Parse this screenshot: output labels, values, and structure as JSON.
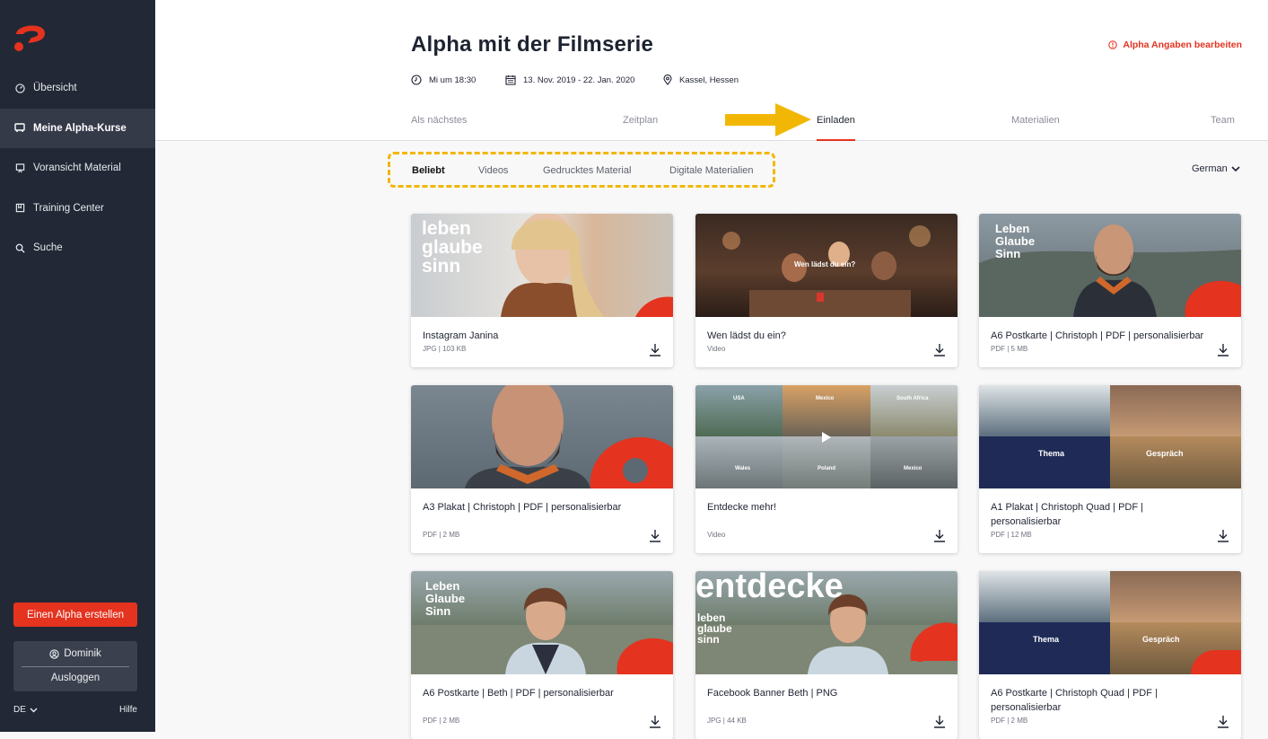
{
  "sidebar": {
    "nav": [
      {
        "label": "Übersicht",
        "icon": "dashboard-icon"
      },
      {
        "label": "Meine Alpha-Kurse",
        "icon": "course-icon"
      },
      {
        "label": "Voransicht Material",
        "icon": "preview-icon"
      },
      {
        "label": "Training Center",
        "icon": "book-icon"
      },
      {
        "label": "Suche",
        "icon": "search-icon"
      }
    ],
    "create_label": "Einen Alpha erstellen",
    "user_name": "Dominik",
    "logout_label": "Ausloggen",
    "lang_label": "DE",
    "help_label": "Hilfe"
  },
  "header": {
    "title": "Alpha mit der Filmserie",
    "edit_label": "Alpha Angaben bearbeiten",
    "time": "Mi um 18:30",
    "dates": "13. Nov. 2019 - 22. Jan. 2020",
    "location": "Kassel, Hessen",
    "tabs": [
      "Als nächstes",
      "Zeitplan",
      "Einladen",
      "Materialien",
      "Team"
    ],
    "active_tab": "Einladen"
  },
  "filters": {
    "items": [
      "Beliebt",
      "Videos",
      "Gedrucktes Material",
      "Digitale Materialien"
    ],
    "active": "Beliebt",
    "language": "German"
  },
  "cards": [
    {
      "title": "Instagram Janina",
      "meta": "JPG | 103 KB",
      "overlay": "leben\nglaube\nsinn"
    },
    {
      "title": "Wen lädst du ein?",
      "meta": "Video",
      "overlay": "Wen lädst du ein?"
    },
    {
      "title": "A6 Postkarte | Christoph | PDF | personalisierbar",
      "meta": "PDF | 5 MB",
      "overlay": "Leben\nGlaube\nSinn"
    },
    {
      "title": "A3 Plakat | Christoph | PDF | personalisierbar",
      "meta": "PDF | 2 MB",
      "overlay": ""
    },
    {
      "title": "Entdecke mehr!",
      "meta": "Video",
      "overlay_labels": [
        "USA",
        "Mexico",
        "South Africa",
        "Wales",
        "Poland",
        "Mexico"
      ]
    },
    {
      "title": "A1 Plakat | Christoph Quad | PDF | personalisierbar",
      "meta": "PDF | 12 MB",
      "overlay_labels": [
        "Thema",
        "Gespräch"
      ]
    },
    {
      "title": "A6 Postkarte | Beth | PDF | personalisierbar",
      "meta": "PDF | 2 MB",
      "overlay": "Leben\nGlaube\nSinn"
    },
    {
      "title": "Facebook Banner Beth | PNG",
      "meta": "JPG | 44 KB",
      "overlay": "entdecke",
      "overlay_small": "leben\nglaube\nsinn"
    },
    {
      "title": "A6 Postkarte | Christoph Quad | PDF | personalisierbar",
      "meta": "PDF | 2 MB",
      "overlay_labels": [
        "Thema",
        "Gespräch"
      ]
    }
  ],
  "colors": {
    "brand_red": "#e4331f",
    "sidebar_bg": "#222836",
    "highlight_yellow": "#f2b705"
  }
}
